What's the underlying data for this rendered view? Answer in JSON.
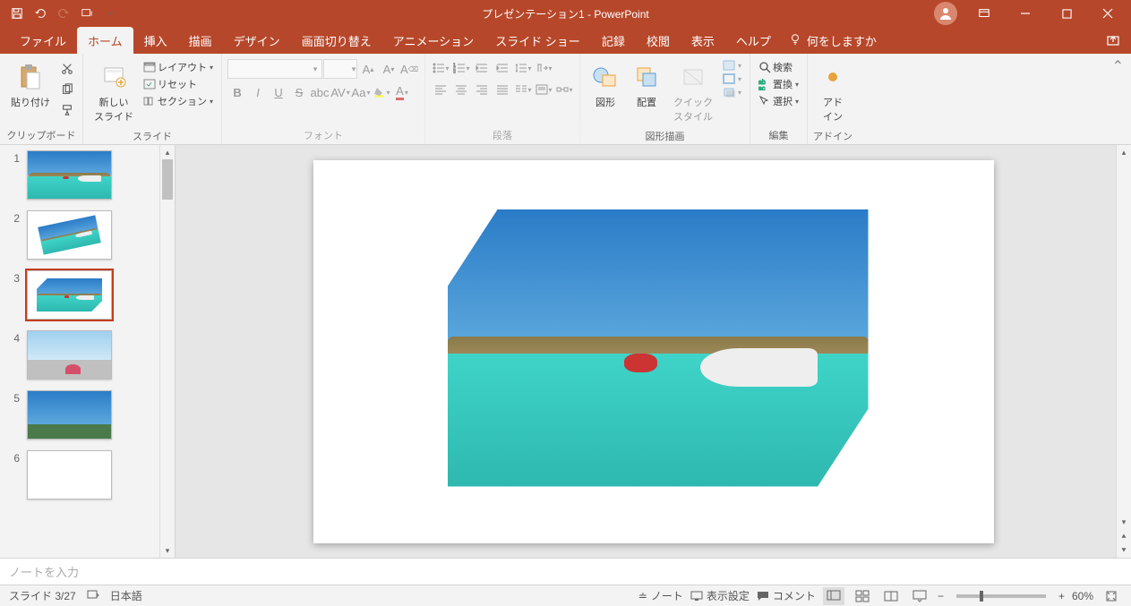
{
  "app": {
    "title": "プレゼンテーション1  -  PowerPoint"
  },
  "menu": {
    "file": "ファイル",
    "home": "ホーム",
    "insert": "挿入",
    "draw": "描画",
    "design": "デザイン",
    "transitions": "画面切り替え",
    "animations": "アニメーション",
    "slideshow": "スライド ショー",
    "record": "記録",
    "review": "校閲",
    "view": "表示",
    "help": "ヘルプ",
    "tellme": "何をしますか"
  },
  "ribbon": {
    "clipboard": {
      "paste": "貼り付け",
      "label": "クリップボード"
    },
    "slides": {
      "new": "新しい\nスライド",
      "layout": "レイアウト",
      "reset": "リセット",
      "section": "セクション",
      "label": "スライド"
    },
    "font": {
      "label": "フォント"
    },
    "paragraph": {
      "label": "段落"
    },
    "drawing": {
      "shapes": "図形",
      "arrange": "配置",
      "quick": "クイック\nスタイル",
      "label": "図形描画"
    },
    "editing": {
      "find": "検索",
      "replace": "置換",
      "select": "選択",
      "label": "編集"
    },
    "addin": {
      "addin": "アド\nイン",
      "label": "アドイン"
    }
  },
  "slides": [
    {
      "n": "1"
    },
    {
      "n": "2"
    },
    {
      "n": "3"
    },
    {
      "n": "4"
    },
    {
      "n": "5"
    },
    {
      "n": "6"
    }
  ],
  "notes": {
    "placeholder": "ノートを入力"
  },
  "status": {
    "slide": "スライド 3/27",
    "lang": "日本語",
    "notes": "ノート",
    "display": "表示設定",
    "comments": "コメント",
    "zoom": "60%"
  }
}
